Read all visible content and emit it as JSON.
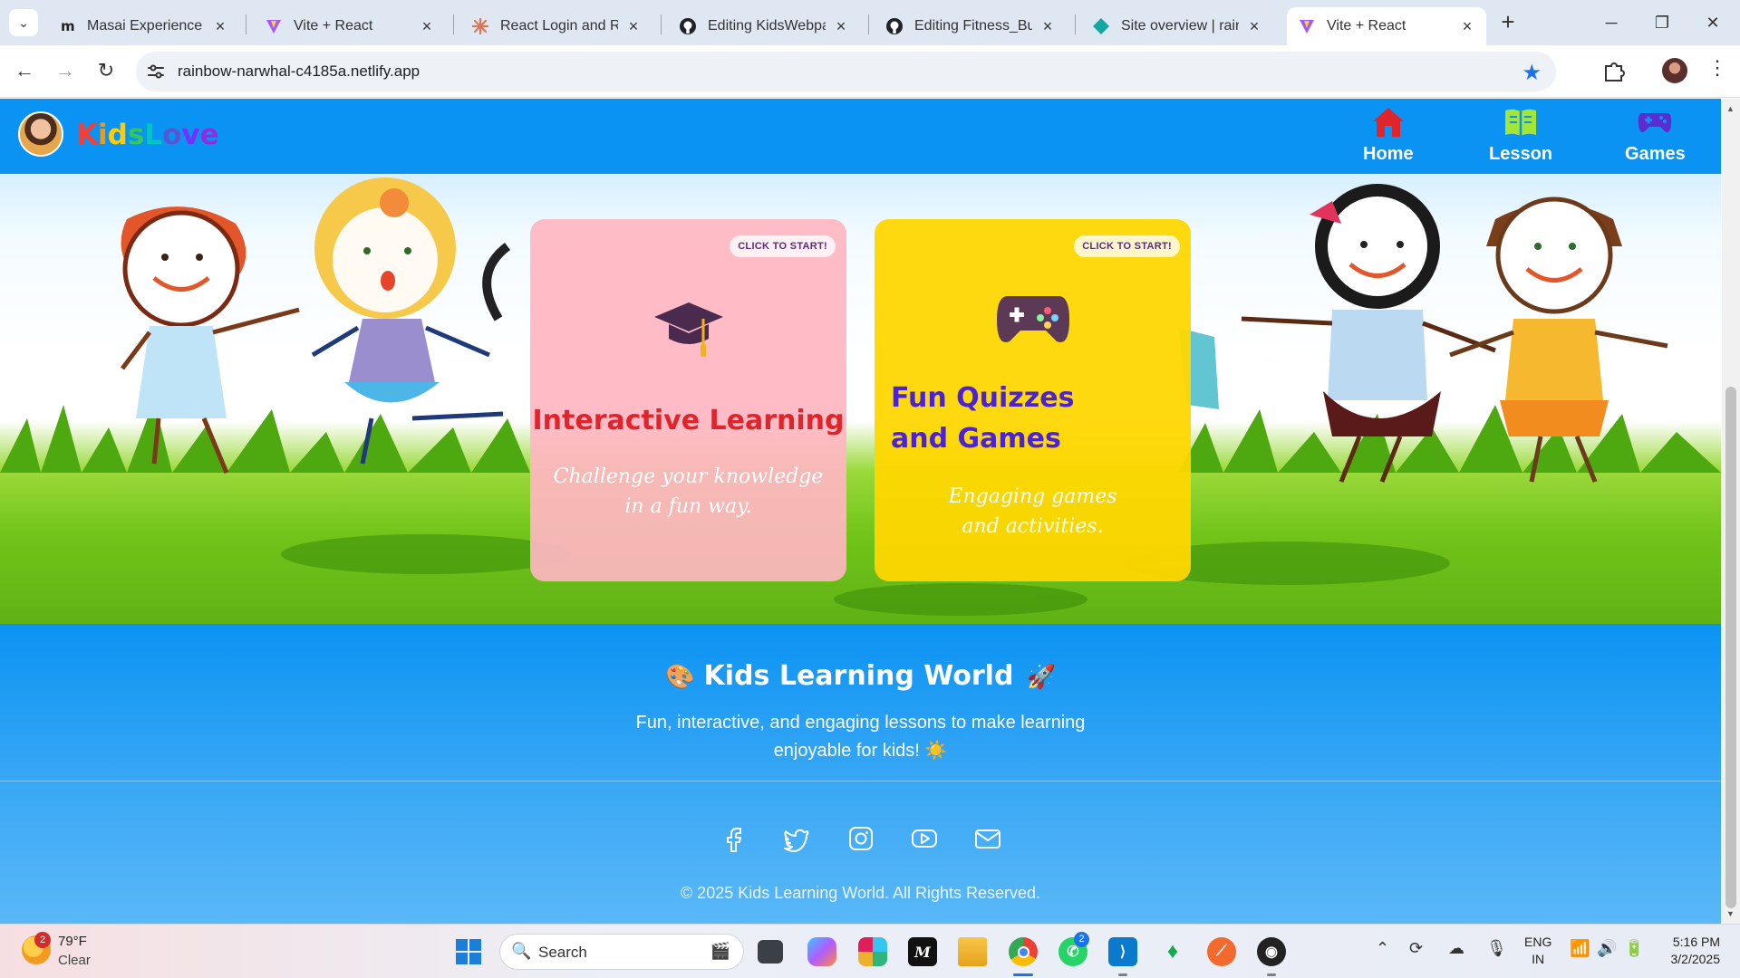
{
  "browser": {
    "tabs": [
      {
        "title": "Masai Experience",
        "icon": "masai-icon",
        "active": false
      },
      {
        "title": "Vite + React",
        "icon": "vite-icon",
        "active": false
      },
      {
        "title": "React Login and Regi",
        "icon": "claude-icon",
        "active": false
      },
      {
        "title": "Editing KidsWebpage",
        "icon": "github-icon",
        "active": false
      },
      {
        "title": "Editing Fitness_Budd",
        "icon": "github-icon",
        "active": false
      },
      {
        "title": "Site overview | rainbo",
        "icon": "netlify-icon",
        "active": false
      },
      {
        "title": "Vite + React",
        "icon": "vite-icon",
        "active": true
      }
    ],
    "url": "rainbow-narwhal-c4185a.netlify.app"
  },
  "site": {
    "brand": {
      "letters": [
        "K",
        "i",
        "d",
        "s",
        "L",
        "o",
        "v",
        "e"
      ],
      "colors": [
        "#ff3b30",
        "#ff9500",
        "#ffcc00",
        "#34c759",
        "#00c7be",
        "#5856d6",
        "#7b2cff",
        "#8e2de2"
      ]
    },
    "nav": [
      {
        "label": "Home",
        "icon": "home-icon",
        "color": "#e0242c"
      },
      {
        "label": "Lesson",
        "icon": "book-icon",
        "color": "#a3e635"
      },
      {
        "label": "Games",
        "icon": "gamepad-icon",
        "color": "#5b2dd1"
      }
    ],
    "cards": [
      {
        "badge": "CLICK TO START!",
        "title": "Interactive Learning",
        "text": "Challenge your knowledge in a fun way.",
        "title_color": "#e0242c",
        "icon": "graduation-cap-icon"
      },
      {
        "badge": "CLICK TO START!",
        "title": "Fun Quizzes and Games",
        "text": "Engaging games and activities.",
        "title_color": "#4b22d6",
        "icon": "gamepad-icon"
      }
    ],
    "footer": {
      "title": "Kids Learning World",
      "tagline_line1": "Fun, interactive, and engaging lessons to make learning",
      "tagline_line2": "enjoyable for kids! ☀️",
      "social": [
        "facebook-icon",
        "twitter-icon",
        "instagram-icon",
        "youtube-icon",
        "mail-icon"
      ],
      "copyright": "© 2025 Kids Learning World. All Rights Reserved."
    }
  },
  "taskbar": {
    "weather_temp": "79°F",
    "weather_cond": "Clear",
    "weather_badge": "2",
    "search_label": "Search",
    "whatsapp_badge": "2",
    "lang_line1": "ENG",
    "lang_line2": "IN",
    "time": "5:16 PM",
    "date": "3/2/2025"
  }
}
